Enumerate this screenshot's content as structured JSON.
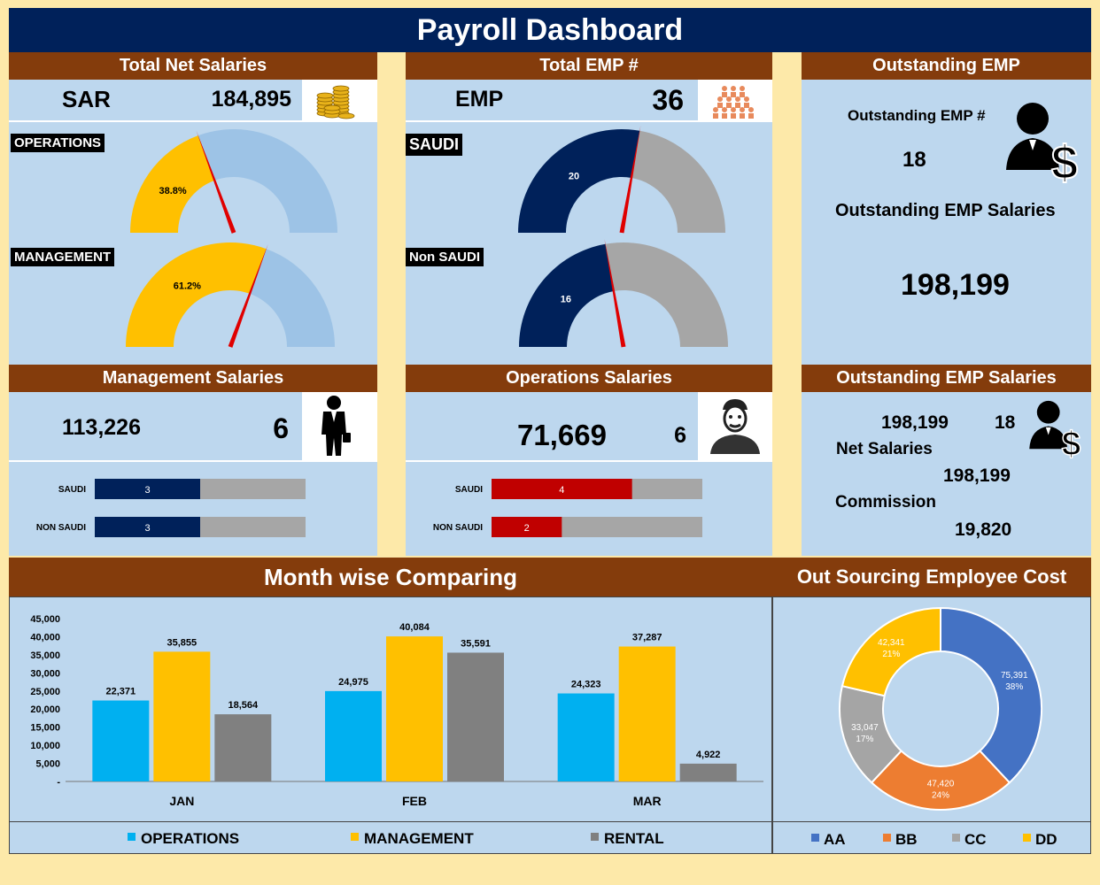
{
  "title": "Payroll Dashboard",
  "net_salaries": {
    "header": "Total Net Salaries",
    "currency": "SAR",
    "amount": "184,895",
    "icon": "coins-icon",
    "gauges": [
      {
        "label": "OPERATIONS",
        "percent": 38.8,
        "percent_label": "38.8%"
      },
      {
        "label": "MANAGEMENT",
        "percent": 61.2,
        "percent_label": "61.2%"
      }
    ]
  },
  "total_emp": {
    "header": "Total EMP #",
    "label": "EMP",
    "count": "36",
    "icon": "people-group-icon",
    "gauges": [
      {
        "label": "SAUDI",
        "value": 20,
        "value_label": "20",
        "total": 36
      },
      {
        "label": "Non SAUDI",
        "value": 16,
        "value_label": "16",
        "total": 36
      }
    ]
  },
  "outstanding": {
    "header": "Outstanding EMP",
    "count_label": "Outstanding EMP #",
    "count": "18",
    "salaries_label": "Outstanding EMP Salaries",
    "salaries": "198,199",
    "icon": "employee-dollar-icon"
  },
  "management_salaries": {
    "header": "Management Salaries",
    "amount": "113,226",
    "count": "6",
    "icon": "businessman-icon",
    "bars": [
      {
        "label": "SAUDI",
        "value": 3,
        "value_label": "3",
        "max": 6
      },
      {
        "label": "NON SAUDI",
        "value": 3,
        "value_label": "3",
        "max": 6
      }
    ]
  },
  "operations_salaries": {
    "header": "Operations Salaries",
    "amount": "71,669",
    "count": "6",
    "icon": "worker-icon",
    "bars": [
      {
        "label": "SAUDI",
        "value": 4,
        "value_label": "4",
        "max": 6
      },
      {
        "label": "NON SAUDI",
        "value": 2,
        "value_label": "2",
        "max": 6
      }
    ]
  },
  "outstanding_salaries": {
    "header": "Outstanding EMP Salaries",
    "amount": "198,199",
    "count": "18",
    "net_label": "Net Salaries",
    "net_value": "198,199",
    "commission_label": "Commission",
    "commission_value": "19,820",
    "icon": "employee-dollar-icon"
  },
  "month_chart_header": "Month wise Comparing",
  "pie_chart_header": "Out Sourcing Employee Cost",
  "colors": {
    "operations": "#00b0f0",
    "management": "#ffc000",
    "rental": "#808080",
    "navy": "#00215a",
    "red": "#c00000",
    "gauge_rest": "#9dc3e6",
    "gray": "#a6a6a6",
    "aa": "#4472c4",
    "bb": "#ed7d31",
    "cc": "#a5a5a5",
    "dd": "#ffc000"
  },
  "chart_data": [
    {
      "type": "bar",
      "title": "Month wise Comparing",
      "categories": [
        "JAN",
        "FEB",
        "MAR"
      ],
      "series": [
        {
          "name": "OPERATIONS",
          "values": [
            22371,
            24975,
            24323
          ],
          "labels": [
            "22,371",
            "24,975",
            "24,323"
          ]
        },
        {
          "name": "MANAGEMENT",
          "values": [
            35855,
            40084,
            37287
          ],
          "labels": [
            "35,855",
            "40,084",
            "37,287"
          ]
        },
        {
          "name": "RENTAL",
          "values": [
            18564,
            35591,
            4922
          ],
          "labels": [
            "18,564",
            "35,591",
            "4,922"
          ]
        }
      ],
      "ylim": [
        0,
        45000
      ],
      "yticks": [
        "-",
        "5,000",
        "10,000",
        "15,000",
        "20,000",
        "25,000",
        "30,000",
        "35,000",
        "40,000",
        "45,000"
      ],
      "legend": "bottom"
    },
    {
      "type": "pie",
      "title": "Out Sourcing Employee Cost",
      "labels": [
        "AA",
        "BB",
        "CC",
        "DD"
      ],
      "values": [
        75391,
        47420,
        33047,
        42341
      ],
      "value_labels": [
        "75,391",
        "47,420",
        "33,047",
        "42,341"
      ],
      "percent_labels": [
        "38%",
        "24%",
        "17%",
        "21%"
      ],
      "legend": "bottom"
    }
  ]
}
